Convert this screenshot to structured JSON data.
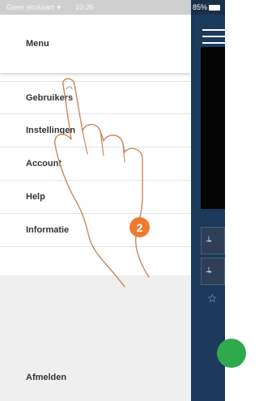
{
  "status": {
    "carrier": "Geen simkaart",
    "time": "10:26",
    "battery": "85%"
  },
  "drawer": {
    "title": "Menu",
    "items": [
      {
        "label": "Gebruikers"
      },
      {
        "label": "Instellingen"
      },
      {
        "label": "Account"
      },
      {
        "label": "Help"
      },
      {
        "label": "Informatie"
      }
    ],
    "logout": "Afmelden"
  },
  "step_badge": "2",
  "colors": {
    "accent_orange": "#ee7c2f",
    "app_blue": "#1c3a5c",
    "green": "#2fa94c"
  },
  "icons": [
    "wifi-icon",
    "battery-icon",
    "hamburger-icon",
    "key-icon",
    "star-icon",
    "hand-pointer-illustration"
  ]
}
